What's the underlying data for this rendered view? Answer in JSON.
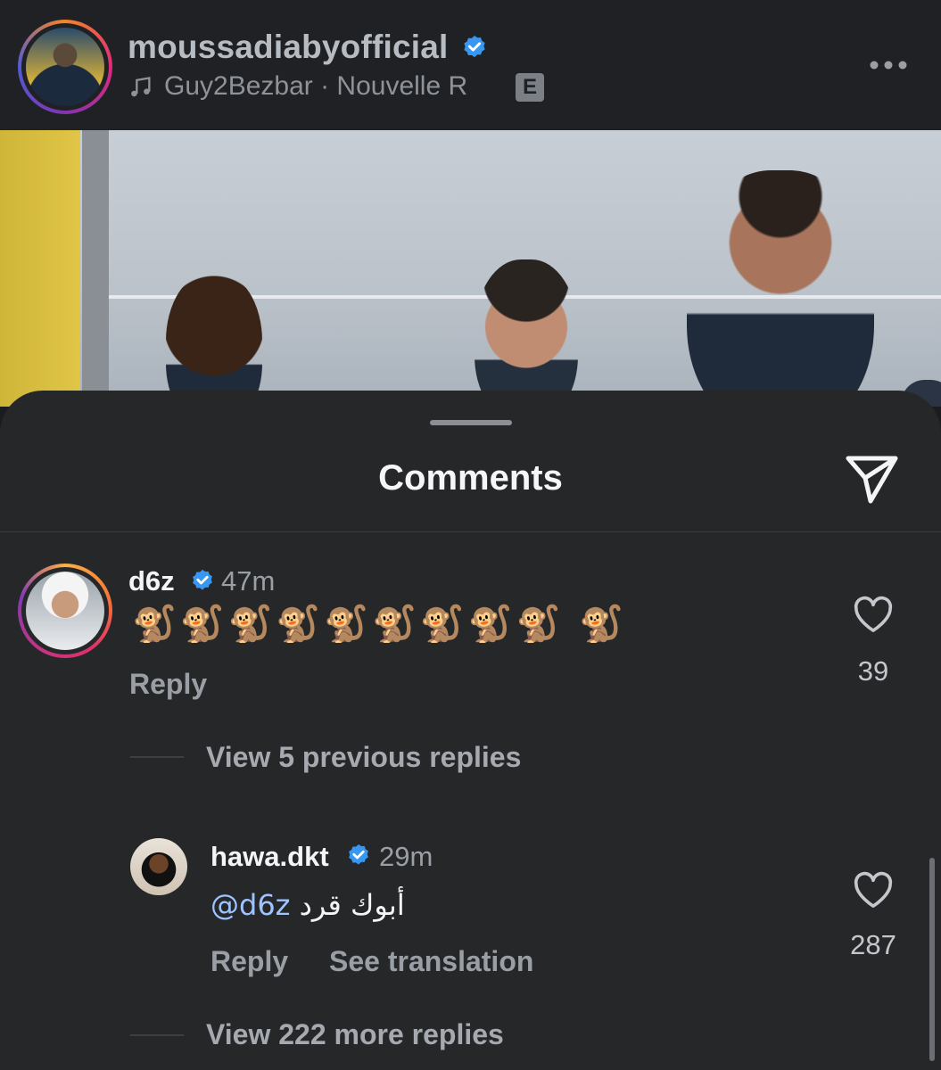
{
  "header": {
    "username": "moussadiabyofficial",
    "verified": true,
    "audio_text": "Guy2Bezbar · Nouvelle R",
    "explicit_badge": "E",
    "more_icon": "more-horizontal-icon"
  },
  "sheet": {
    "title": "Comments",
    "send_icon": "paper-plane-icon"
  },
  "comments": [
    {
      "username": "d6z",
      "verified": true,
      "time": "47m",
      "text": "🐒🐒🐒🐒🐒🐒🐒🐒🐒 🐒",
      "reply_label": "Reply",
      "likes": "39",
      "view_replies": "View 5 previous replies"
    },
    {
      "username": "hawa.dkt",
      "verified": true,
      "time": "29m",
      "mention": "@d6z",
      "text": "أبوك قرد",
      "reply_label": "Reply",
      "translate_label": "See translation",
      "likes": "287",
      "view_replies": "View 222 more replies"
    }
  ],
  "colors": {
    "background": "#262729",
    "header_bg": "#202124",
    "verified_blue": "#3897f0",
    "mention_blue": "#9ec4ff",
    "muted_text": "#9a9ea5"
  }
}
